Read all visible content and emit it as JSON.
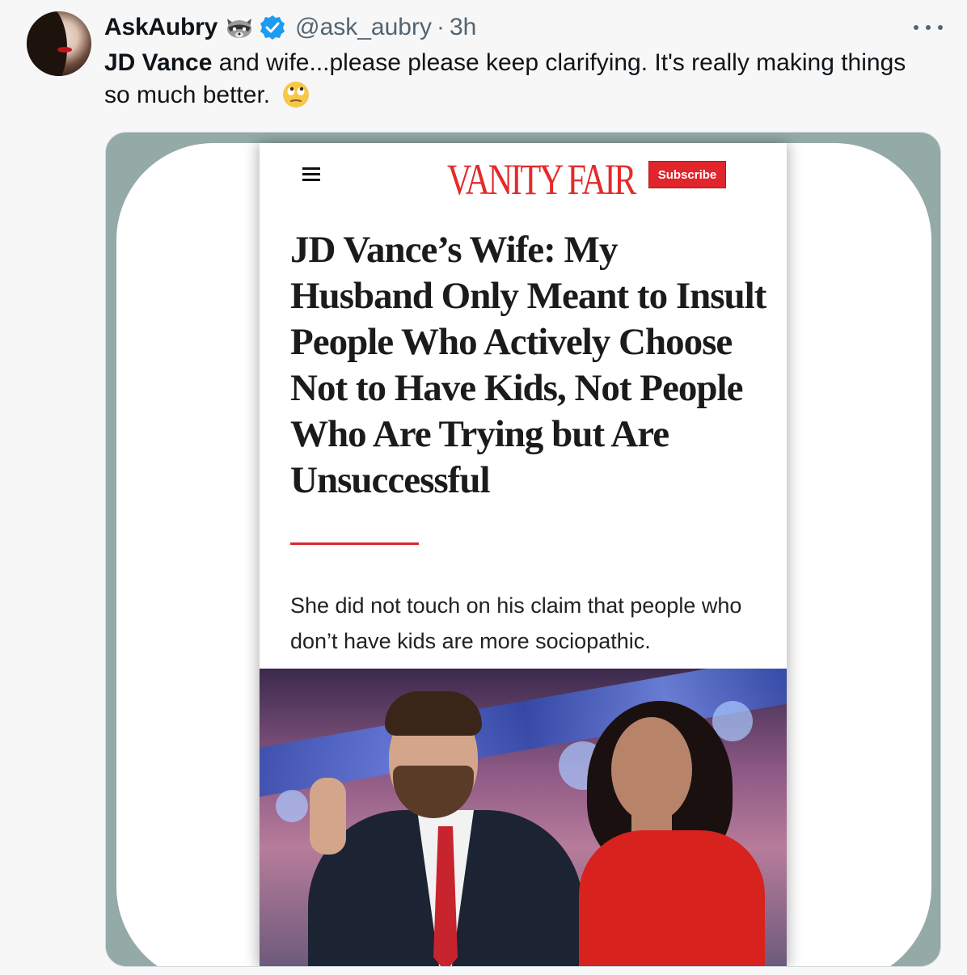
{
  "tweet": {
    "display_name": "AskAubry",
    "handle": "@ask_aubry",
    "separator": "·",
    "time": "3h",
    "name_emoji_icon": "raccoon-icon",
    "verified_icon": "verified-badge-icon",
    "more_icon": "more-options-icon",
    "text_bold": "JD Vance",
    "text_rest": " and wife...please please keep clarifying. It's really making things so much better.",
    "text_emoji_icon": "face-with-rolling-eyes-icon"
  },
  "article": {
    "brand": "VANITY FAIR",
    "subscribe_label": "Subscribe",
    "menu_icon": "hamburger-menu-icon",
    "headline": "JD Vance’s Wife: My Husband Only Meant to Insult People Who Actively Choose Not to Have Kids, Not People Who Are Trying but Are Unsuccessful",
    "dek": "She did not touch on his claim that people who don’t have kids are more sociopathic.",
    "accent_color": "#e32b2b"
  },
  "colors": {
    "link_gray": "#536471",
    "verified_blue": "#1d9bf0",
    "card_frame": "#93aaa7"
  }
}
